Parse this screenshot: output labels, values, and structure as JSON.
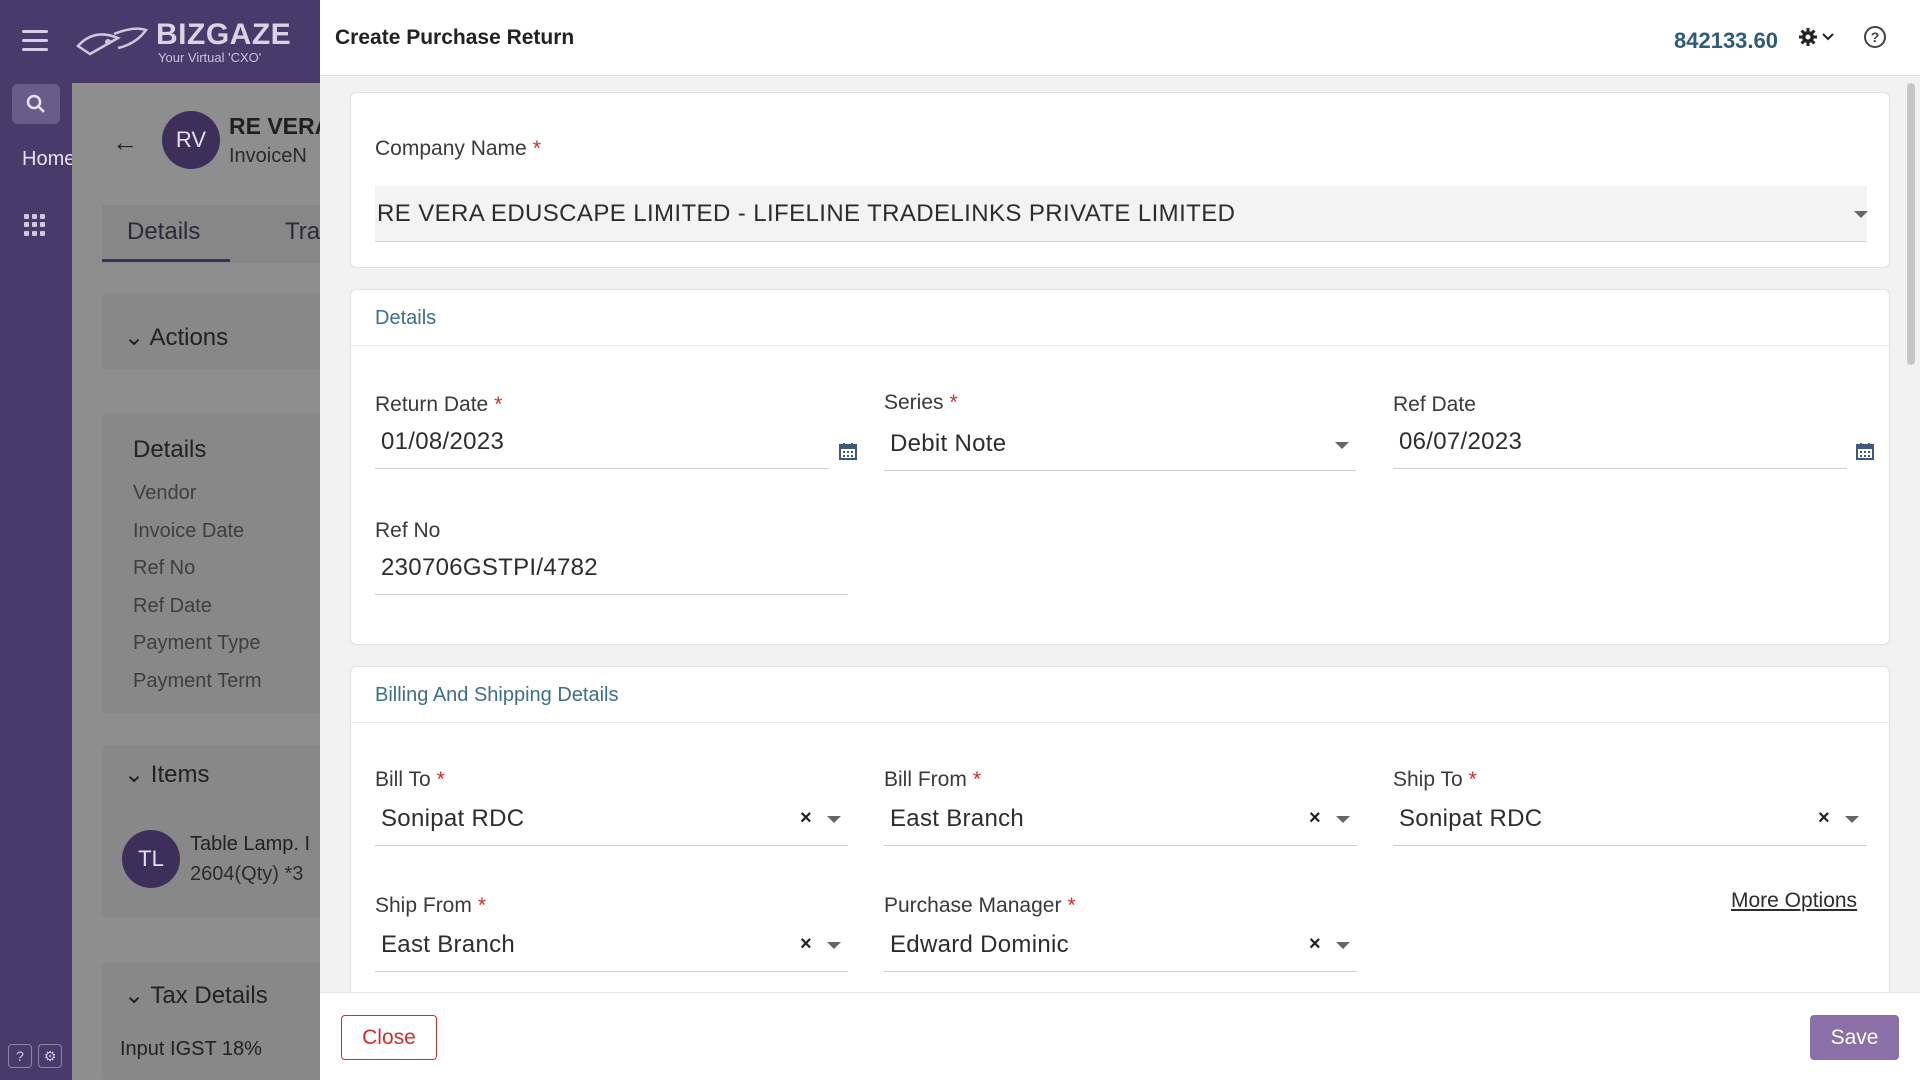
{
  "app": {
    "brand": "BIZGAZE",
    "tagline": "Your Virtual 'CXO'",
    "nav_home": "Home"
  },
  "background": {
    "avatar_initials": "RV",
    "record_title": "RE VERA",
    "record_sub": "InvoiceN",
    "tabs": [
      "Details",
      "Tra"
    ],
    "actions_label": "Actions",
    "details_title": "Details",
    "details_rows": [
      "Vendor",
      "Invoice Date",
      "Ref No",
      "Ref Date",
      "Payment Type",
      "Payment Term"
    ],
    "items_title": "Items",
    "item_avatar": "TL",
    "item_name": "Table Lamp. I",
    "item_qty": "2604(Qty) *3",
    "tax_title": "Tax Details",
    "tax_row": "Input IGST 18%"
  },
  "modal": {
    "title": "Create Purchase Return",
    "amount": "842133.60",
    "help_glyph": "?",
    "company": {
      "label": "Company Name",
      "value": "RE VERA EDUSCAPE LIMITED - LIFELINE TRADELINKS PRIVATE LIMITED"
    },
    "details_section": {
      "title": "Details",
      "return_date": {
        "label": "Return Date",
        "value": "01/08/2023"
      },
      "series": {
        "label": "Series",
        "value": "Debit Note"
      },
      "ref_date": {
        "label": "Ref Date",
        "value": "06/07/2023"
      },
      "ref_no": {
        "label": "Ref No",
        "value": "230706GSTPI/4782"
      }
    },
    "billing_section": {
      "title": "Billing And Shipping Details",
      "bill_to": {
        "label": "Bill To",
        "value": "Sonipat RDC"
      },
      "bill_from": {
        "label": "Bill From",
        "value": "East Branch"
      },
      "ship_to": {
        "label": "Ship To",
        "value": "Sonipat RDC"
      },
      "ship_from": {
        "label": "Ship From",
        "value": "East Branch"
      },
      "purchase_manager": {
        "label": "Purchase Manager",
        "value": "Edward Dominic"
      },
      "more_options": "More Options"
    },
    "required_mark": "*",
    "clear_glyph": "×",
    "close_label": "Close",
    "save_label": "Save"
  },
  "colors": {
    "rail": "#4a3a6b",
    "accent": "#8a6fa8",
    "section_title": "#3d6f88",
    "required": "#d22b2b",
    "amount": "#2f5b78"
  }
}
